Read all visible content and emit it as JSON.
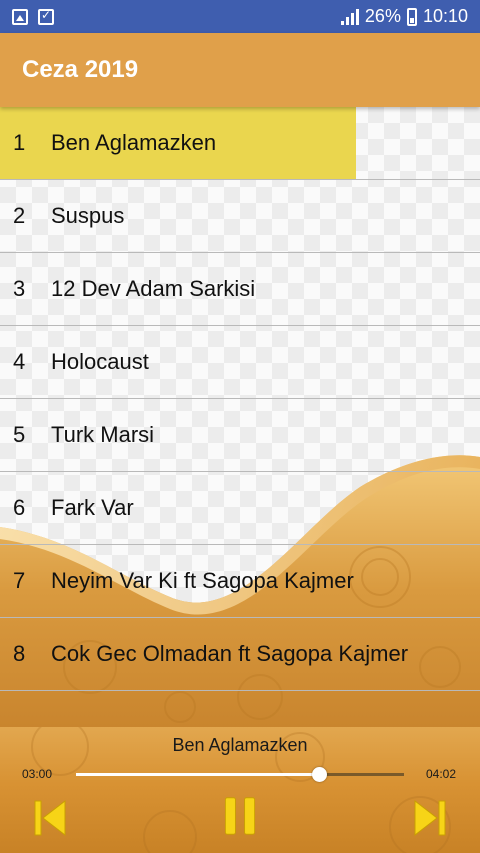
{
  "status": {
    "battery": "26%",
    "time": "10:10"
  },
  "app": {
    "title": "Ceza 2019"
  },
  "tracks": [
    {
      "num": "1",
      "title": "Ben Aglamazken"
    },
    {
      "num": "2",
      "title": "Suspus"
    },
    {
      "num": "3",
      "title": "12 Dev Adam Sarkisi"
    },
    {
      "num": "4",
      "title": "Holocaust"
    },
    {
      "num": "5",
      "title": "Turk Marsi"
    },
    {
      "num": "6",
      "title": "Fark Var"
    },
    {
      "num": "7",
      "title": "Neyim Var Ki ft Sagopa Kajmer"
    },
    {
      "num": "8",
      "title": "Cok Gec Olmadan ft Sagopa Kajmer"
    }
  ],
  "selected_index": 0,
  "player": {
    "now_playing": "Ben Aglamazken",
    "elapsed": "03:00",
    "duration": "04:02",
    "progress": 0.74
  },
  "colors": {
    "status_bar": "#3F5EAF",
    "app_bar": "#E0A04A",
    "highlight": "#EAD64E",
    "icon_yellow": "#F7D417"
  },
  "icons": [
    "image-icon",
    "checklist-icon",
    "signal-icon",
    "battery-icon",
    "previous-icon",
    "pause-icon",
    "next-icon"
  ]
}
